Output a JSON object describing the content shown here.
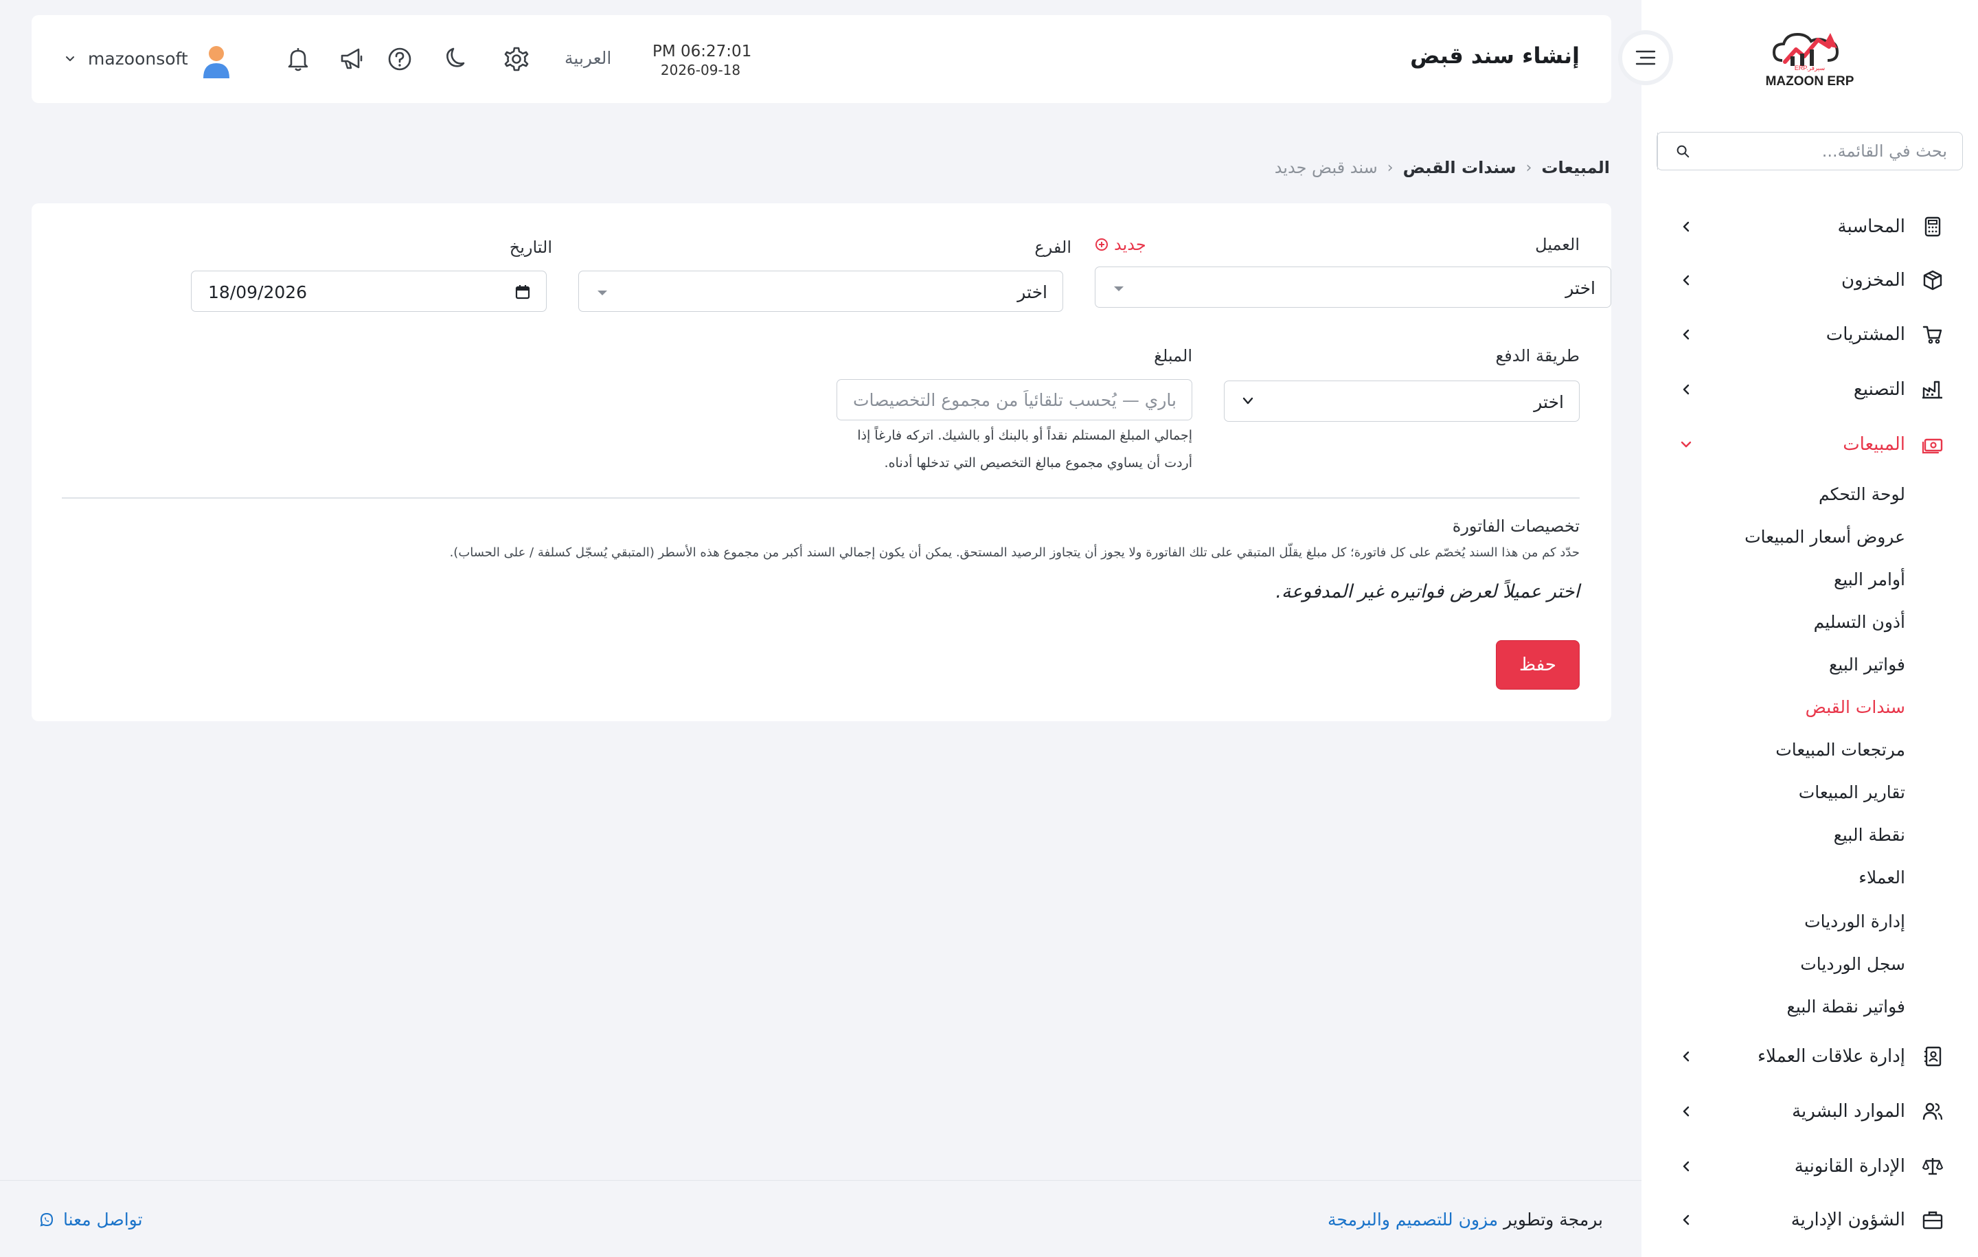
{
  "app": {
    "logo_text": "MAZOON ERP",
    "logo_sub": "ERP.سيرفر"
  },
  "sidebar": {
    "search_placeholder": "بحث في القائمة...",
    "items": [
      {
        "label": "المحاسبة",
        "icon": "calculator-icon"
      },
      {
        "label": "المخزون",
        "icon": "box-icon"
      },
      {
        "label": "المشتريات",
        "icon": "cart-icon"
      },
      {
        "label": "التصنيع",
        "icon": "factory-icon"
      },
      {
        "label": "المبيعات",
        "icon": "cash-icon",
        "active": true
      },
      {
        "label": "إدارة علاقات العملاء",
        "icon": "contacts-icon"
      },
      {
        "label": "الموارد البشرية",
        "icon": "users-icon"
      },
      {
        "label": "الإدارة القانونية",
        "icon": "scale-icon"
      },
      {
        "label": "الشؤون الإدارية",
        "icon": "briefcase-icon"
      }
    ],
    "sales_sub": [
      "لوحة التحكم",
      "عروض أسعار المبيعات",
      "أوامر البيع",
      "أذون التسليم",
      "فواتير البيع",
      "سندات القبض",
      "مرتجعات المبيعات",
      "تقارير المبيعات",
      "نقطة البيع",
      "العملاء",
      "إدارة الورديات",
      "سجل الورديات",
      "فواتير نقطة البيع"
    ],
    "active_sub": "سندات القبض"
  },
  "header": {
    "title": "إنشاء سند قبض",
    "time": "PM 06:27:01",
    "date": "2026-09-18",
    "language": "العربية",
    "username": "mazoonsoft"
  },
  "breadcrumb": {
    "root": "المبيعات",
    "parent": "سندات القبض",
    "current": "سند قبض جديد",
    "separator": "‹"
  },
  "form": {
    "customer_label": "العميل",
    "new_label": "جديد",
    "customer_value": "اختر",
    "branch_label": "الفرع",
    "branch_value": "اختر",
    "date_label": "التاريخ",
    "date_value": "18/09/2026",
    "payment_label": "طريقة الدفع",
    "payment_value": "اختر",
    "amount_label": "المبلغ",
    "amount_placeholder": "باري — يُحسب تلقائياً من مجموع التخصيصات",
    "amount_hint_1": "إجمالي المبلغ المستلم نقداً أو بالبنك أو بالشيك. اتركه فارغاً إذا",
    "amount_hint_2": "أردت أن يساوي مجموع مبالغ التخصيص التي تدخلها أدناه.",
    "allocations_title": "تخصيصات الفاتورة",
    "allocations_desc": "حدّد كم من هذا السند يُخصّم على كل فاتورة؛ كل مبلغ يقلّل المتبقي على تلك الفاتورة ولا يجوز أن يتجاوز الرصيد المستحق. يمكن أن يكون إجمالي السند أكبر من مجموع هذه الأسطر (المتبقي يُسجّل كسلفة / على الحساب).",
    "empty_message": "اختر عميلاً لعرض فواتيره غير المدفوعة.",
    "save_label": "حفظ"
  },
  "footer": {
    "credit_prefix": "برمجة وتطوير",
    "credit_brand": "مزون للتصميم والبرمجة",
    "contact": "تواصل معنا"
  },
  "colors": {
    "accent": "#e8364a",
    "link": "#1a73c9",
    "background": "#f3f4f8"
  }
}
